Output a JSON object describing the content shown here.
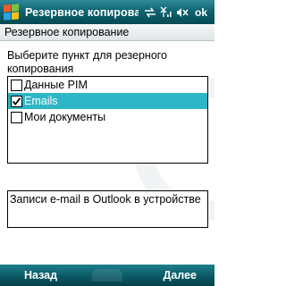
{
  "titlebar": {
    "title": "Резервное копирова",
    "ok_label": "ok",
    "icons": [
      "windows-start-icon",
      "connectivity-icon",
      "signal-icon",
      "volume-muted-icon"
    ]
  },
  "header": {
    "title": "Резервное копирование"
  },
  "main": {
    "instruction": "Выберите пункт для резерного копирования",
    "items": [
      {
        "label": "Данные PIM",
        "checked": false,
        "selected": false
      },
      {
        "label": "Emails",
        "checked": true,
        "selected": true
      },
      {
        "label": "Мои документы",
        "checked": false,
        "selected": false
      }
    ],
    "description": "Записи e-mail в Outlook в устройстве"
  },
  "menubar": {
    "left_label": "Назад",
    "right_label": "Далее"
  },
  "colors": {
    "titlebar": "#0f6470",
    "selection": "#2fb6c6",
    "menubar": "#0b5d68"
  }
}
